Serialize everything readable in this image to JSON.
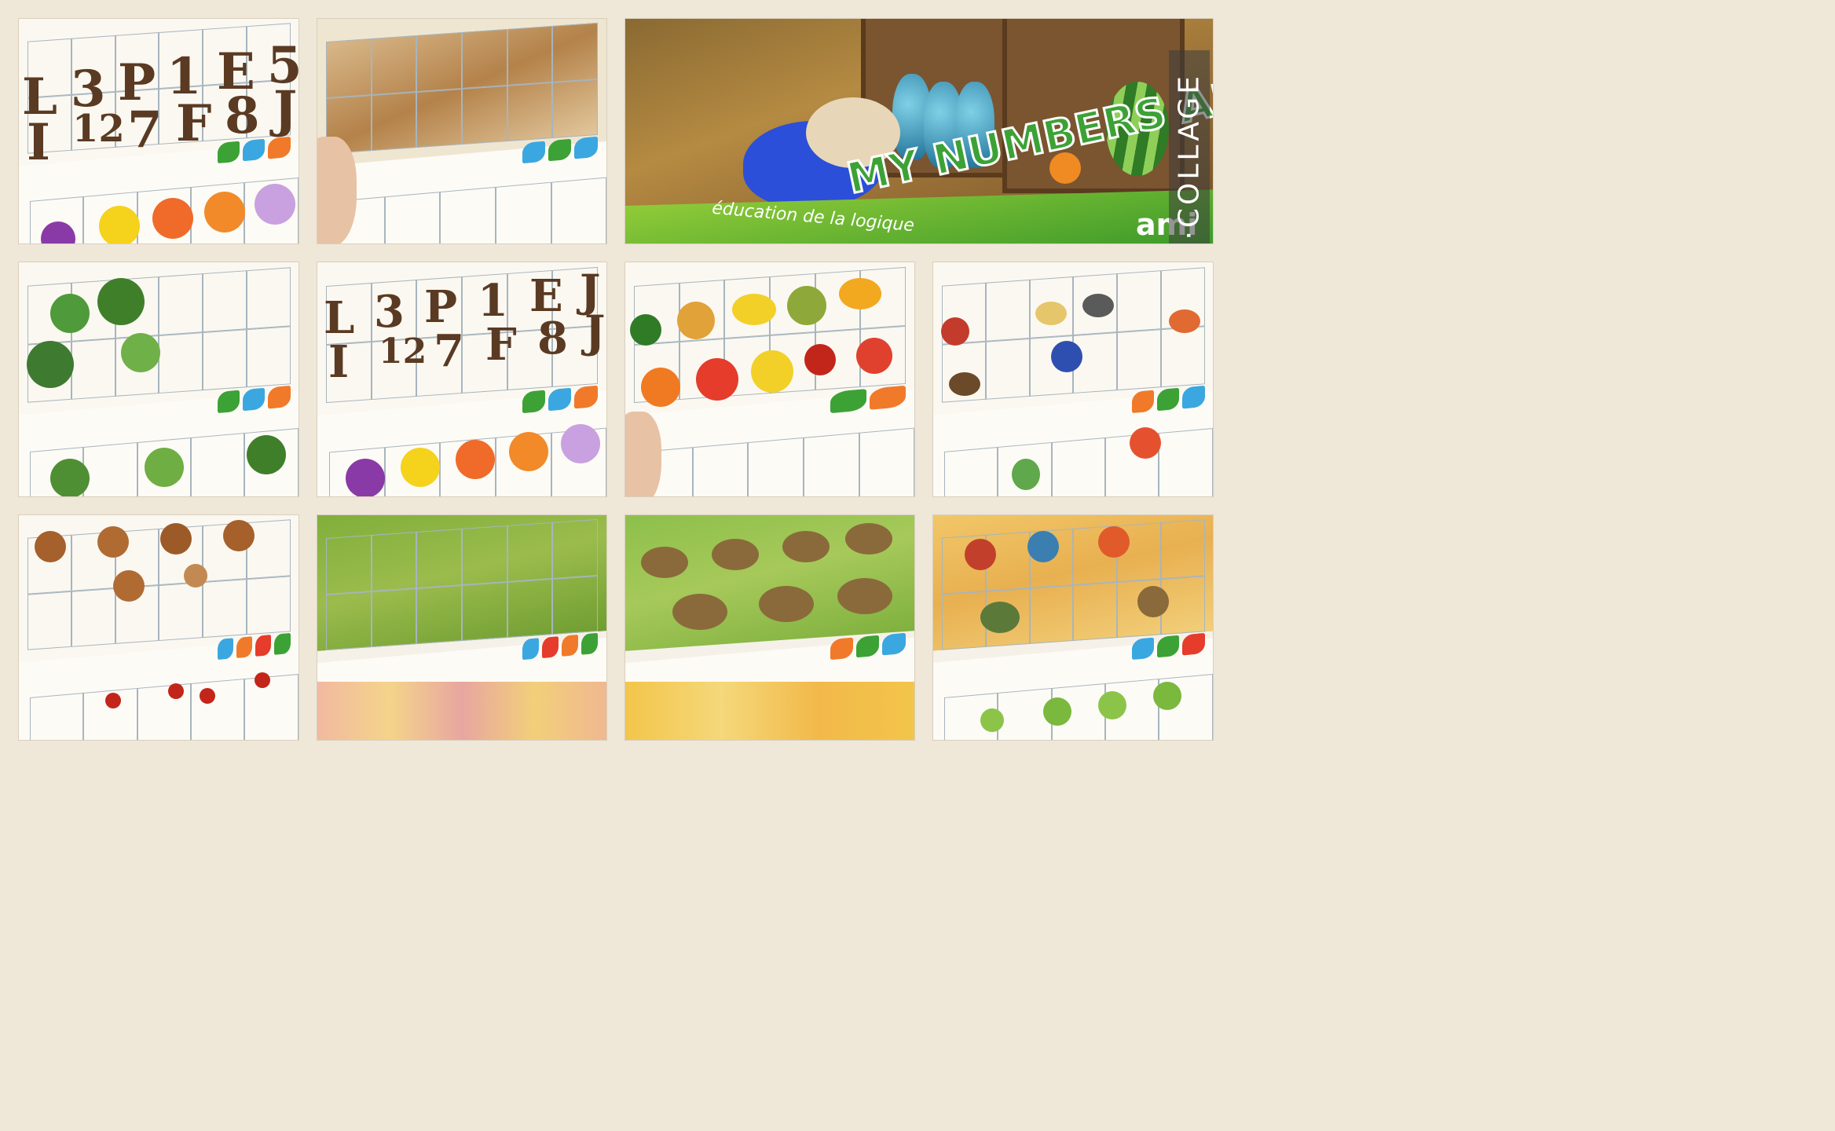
{
  "collage": {
    "background_color": "#efe7d8",
    "watermark": "PIC·COLLAGE"
  },
  "cover": {
    "title": "MY NUMBERS ARE GONE",
    "subtitle": "éducation de la logique",
    "brand": "ami"
  },
  "panels": [
    {
      "id": "numbers-letters-1",
      "glyphs": [
        "L",
        "3",
        "P",
        "1",
        "E",
        "5",
        "I",
        "12",
        "7",
        "F",
        "8",
        "J"
      ]
    },
    {
      "id": "bread-slices"
    },
    {
      "id": "cover"
    },
    {
      "id": "vegetables"
    },
    {
      "id": "numbers-letters-2",
      "glyphs": [
        "L",
        "3",
        "P",
        "1",
        "E",
        "J",
        "I",
        "12",
        "7",
        "F",
        "8",
        "J"
      ]
    },
    {
      "id": "fruits"
    },
    {
      "id": "tools"
    },
    {
      "id": "muffins-cherries"
    },
    {
      "id": "field"
    },
    {
      "id": "nests-eggs"
    },
    {
      "id": "toys"
    }
  ],
  "colors": {
    "grid_line": "#a7b5be",
    "blue_accent": "#3aa7e0",
    "green_accent": "#3ca236",
    "orange_accent": "#f07a2a",
    "red_accent": "#e53c2b"
  }
}
